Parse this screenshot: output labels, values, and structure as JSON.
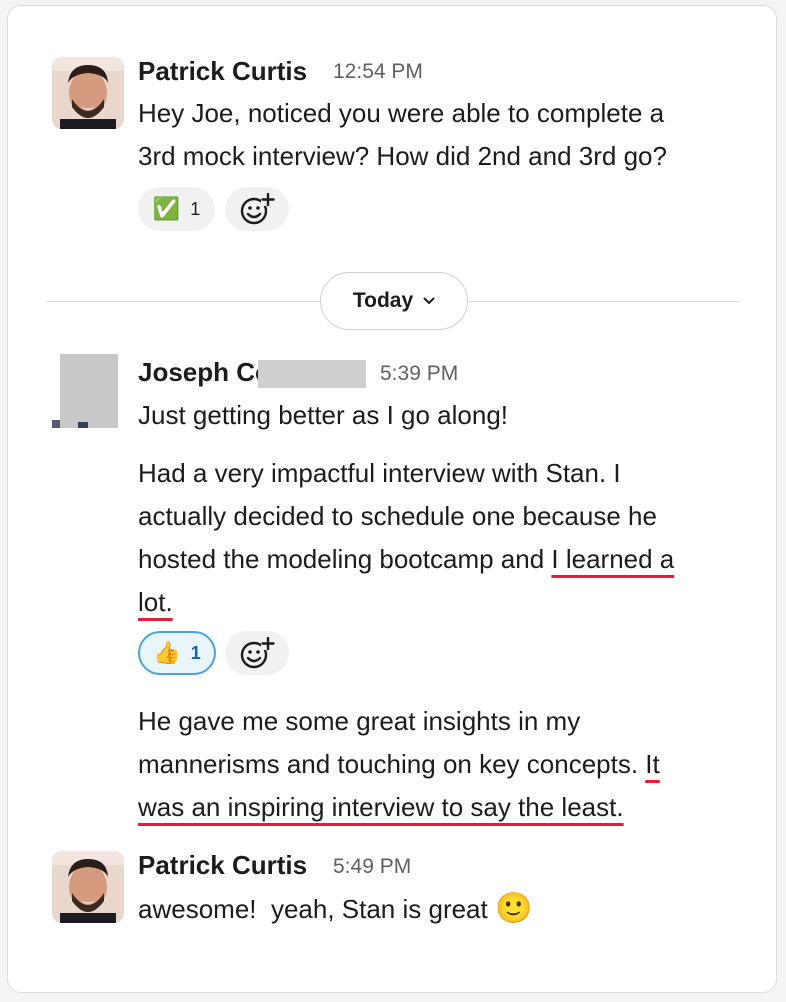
{
  "messages": [
    {
      "author": "Patrick Curtis",
      "time": "12:54 PM",
      "line1": "Hey Joe, noticed you were able to complete a",
      "line2": "3rd mock interview? How did 2nd and 3rd go?",
      "reaction": {
        "emoji": "✅",
        "count": "1"
      }
    },
    {
      "author": "Joseph Co",
      "time": "5:39 PM",
      "line1": "Just getting better as I go along!",
      "p2": {
        "line1": "Had a very impactful interview with Stan. I",
        "line2": "actually decided to schedule one because he",
        "line3_plain": "hosted the modeling bootcamp and ",
        "line3_ul": "I learned a",
        "line4_ul": "lot."
      },
      "reaction": {
        "emoji": "👍",
        "count": "1"
      },
      "p3": {
        "line1": "He gave me some great insights in my",
        "line2_plain": "mannerisms and touching on key concepts. ",
        "line2_ul": "It",
        "line3_ul": "was an inspiring interview to say the least."
      }
    },
    {
      "author": "Patrick Curtis",
      "time": "5:49 PM",
      "text": "awesome!  yeah, Stan is great",
      "emoji": "🙂"
    }
  ],
  "divider": {
    "label": "Today"
  },
  "icons": {
    "add_reaction": "add-reaction-icon",
    "chevron": "chevron-down-icon"
  },
  "colors": {
    "underline": "#e01e3c",
    "reaction_active_border": "#4aa3d7"
  }
}
